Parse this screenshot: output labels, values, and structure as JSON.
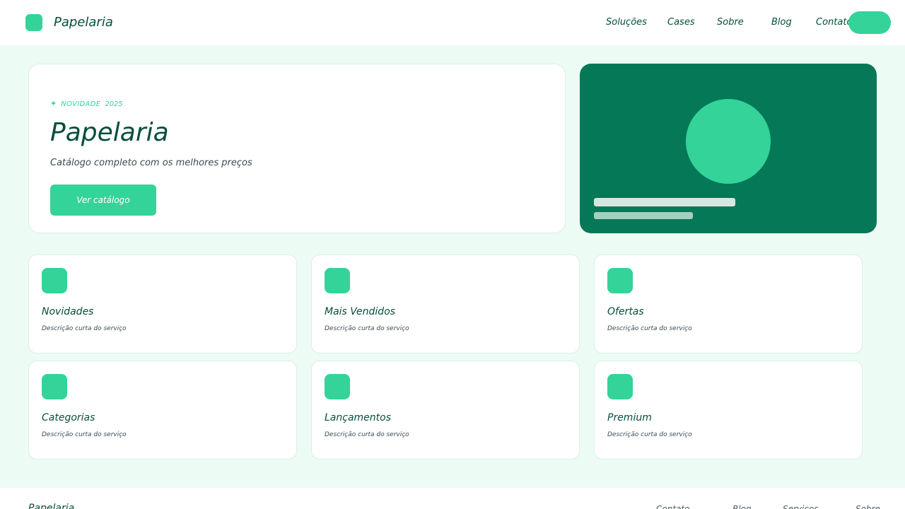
{
  "header": {
    "logo_text": "Papelaria",
    "nav": [
      {
        "label": "Soluções"
      },
      {
        "label": "Cases"
      },
      {
        "label": "Sobre"
      },
      {
        "label": "Blog"
      },
      {
        "label": "Contato"
      }
    ],
    "cta_label": ""
  },
  "hero": {
    "badge_icon": "sparkle-icon",
    "badge_tag": "Novidade",
    "badge_year": "2025",
    "title": "Papelaria",
    "subtitle": "Catálogo completo com os melhores preços",
    "button_label": "Ver catálogo"
  },
  "features": [
    {
      "title": "Novidades",
      "description": "Descrição curta do serviço"
    },
    {
      "title": "Mais Vendidos",
      "description": "Descrição curta do serviço"
    },
    {
      "title": "Ofertas",
      "description": "Descrição curta do serviço"
    },
    {
      "title": "Categorias",
      "description": "Descrição curta do serviço"
    },
    {
      "title": "Lançamentos",
      "description": "Descrição curta do serviço"
    },
    {
      "title": "Premium",
      "description": "Descrição curta do serviço"
    }
  ],
  "footer": {
    "brand": "Papelaria",
    "links": [
      {
        "label": "Contato"
      },
      {
        "label": "Blog"
      },
      {
        "label": "Serviços"
      },
      {
        "label": "Sobre"
      }
    ]
  },
  "colors": {
    "accent": "#34d399",
    "dark_green": "#047857",
    "text": "#064e3b",
    "background": "#ecfbf4"
  }
}
